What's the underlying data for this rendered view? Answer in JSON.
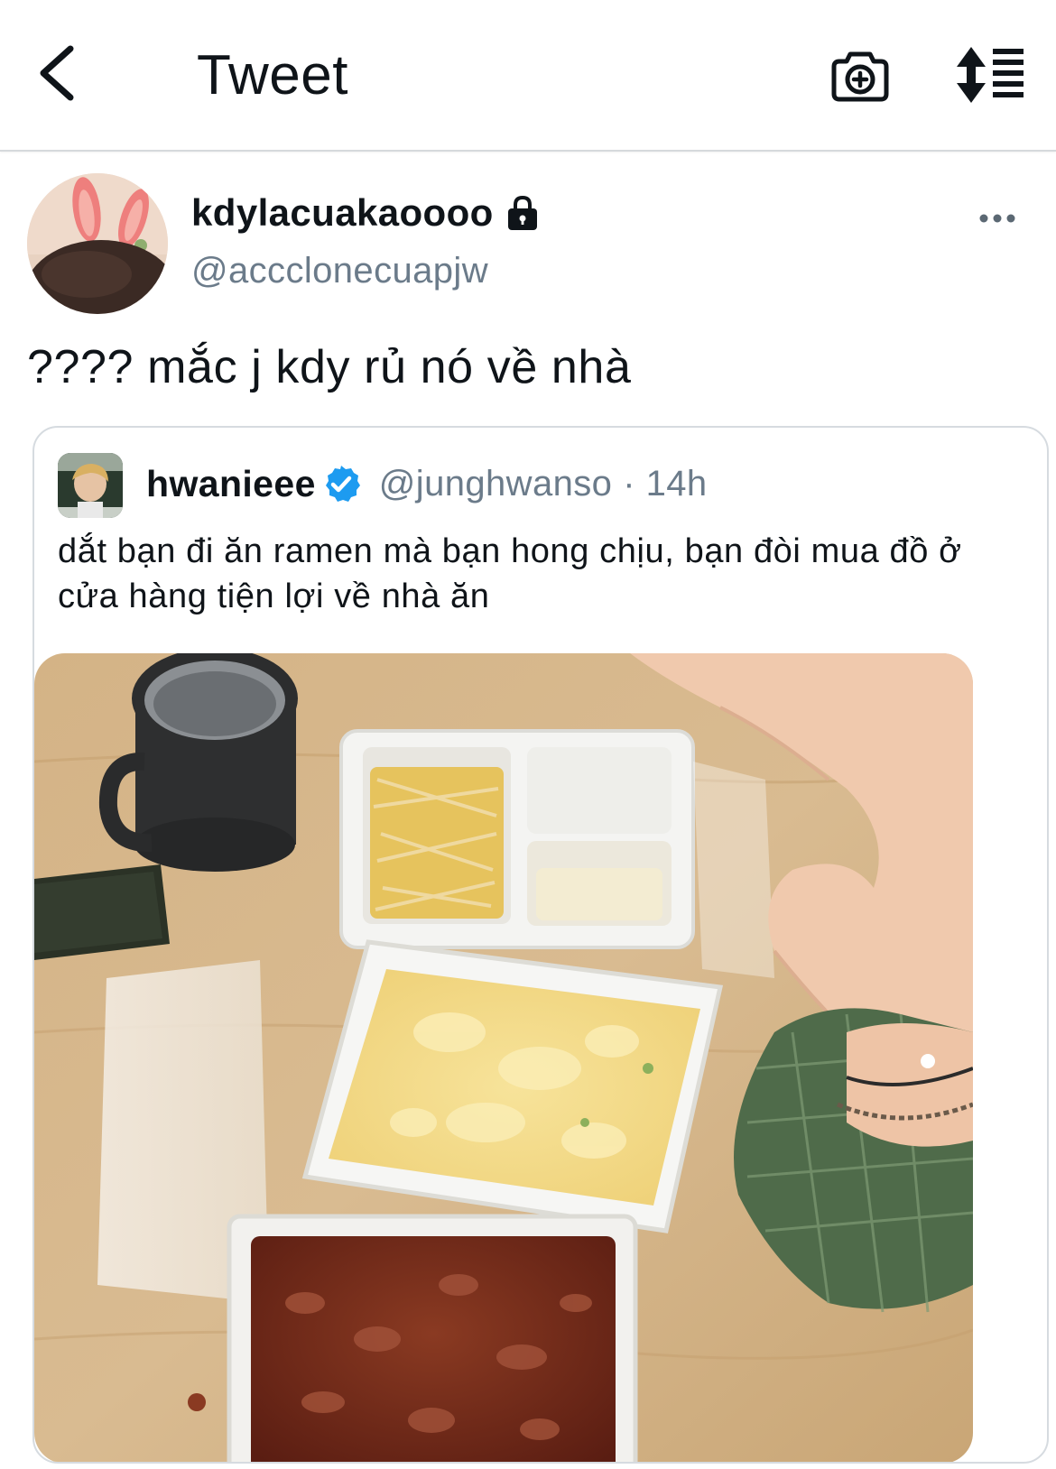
{
  "header": {
    "title": "Tweet",
    "back_icon": "chevron-left-icon",
    "camera_icon": "camera-add-icon",
    "sort_icon": "sort-list-icon"
  },
  "tweet": {
    "author_name": "kdylacuakaoooo",
    "author_handle": "@accclonecuapjw",
    "protected_icon": "lock-icon",
    "more_icon": "more-horizontal-icon",
    "text": "???? mắc j kdy rủ nó về nhà"
  },
  "quoted_tweet": {
    "author_name": "hwanieee",
    "verified_icon": "verified-badge-icon",
    "author_handle": "@junghwanso",
    "separator": "·",
    "time": "14h",
    "text": "dắt bạn đi ăn ramen mà bạn hong chịu, bạn đòi mua đồ ở cửa hàng tiện lợi về nhà ăn"
  },
  "colors": {
    "text_primary": "#0f1419",
    "text_secondary": "#6b7b8a",
    "verified_blue": "#1d9bf0",
    "divider": "#d6d9dc"
  }
}
